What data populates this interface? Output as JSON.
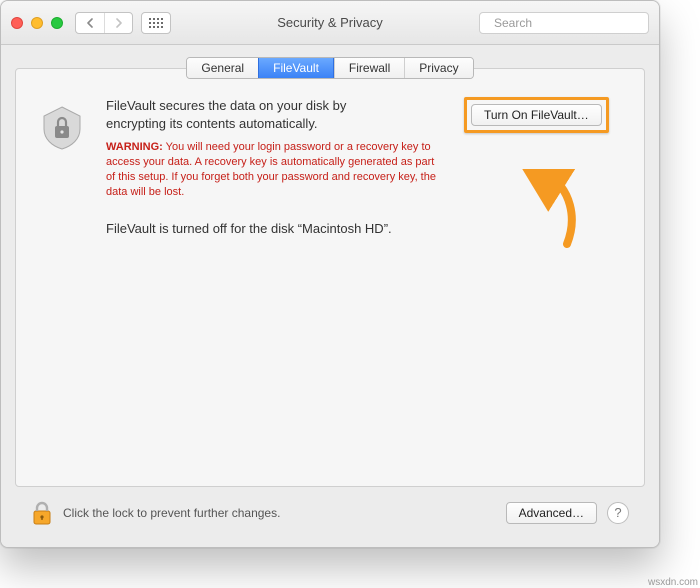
{
  "header": {
    "title": "Security & Privacy",
    "search_placeholder": "Search"
  },
  "tabs": {
    "general": "General",
    "filevault": "FileVault",
    "firewall": "Firewall",
    "privacy": "Privacy",
    "selected": "filevault"
  },
  "main": {
    "description": "FileVault secures the data on your disk by encrypting its contents automatically.",
    "warning_label": "WARNING:",
    "warning_text": " You will need your login password or a recovery key to access your data. A recovery key is automatically generated as part of this setup. If you forget both your password and recovery key, the data will be lost.",
    "status": "FileVault is turned off for the disk “Macintosh HD”.",
    "turn_on_label": "Turn On FileVault…"
  },
  "footer": {
    "lock_text": "Click the lock to prevent further changes.",
    "advanced_label": "Advanced…",
    "help_label": "?"
  },
  "attribution": "wsxdn.com"
}
